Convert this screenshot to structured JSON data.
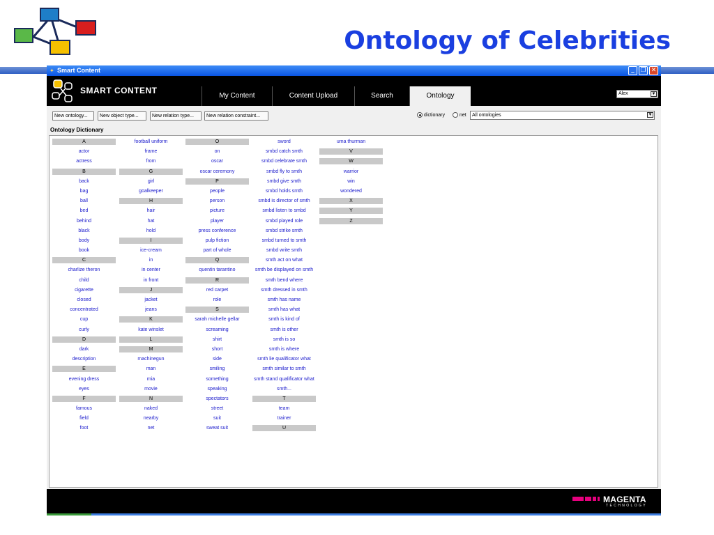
{
  "slide": {
    "title": "Ontology of Celebrities"
  },
  "window": {
    "title": "Smart Content"
  },
  "app": {
    "logo_text": "SMART CONTENT",
    "tabs": [
      {
        "label": "My Content"
      },
      {
        "label": "Content Upload"
      },
      {
        "label": "Search"
      },
      {
        "label": "Ontology",
        "active": true
      }
    ],
    "user": "Alex"
  },
  "toolbar": {
    "new_ontology": "New ontology...",
    "new_object_type": "New object type...",
    "new_relation_type": "New relation type...",
    "new_relation_constraint": "New relation constraint...",
    "radio_dictionary": "dictionary",
    "radio_net": "net",
    "selected_view": "dictionary",
    "ontology_select": "All ontologies"
  },
  "dictionary": {
    "legend": "Ontology Dictionary",
    "columns": [
      [
        "#A",
        "actor",
        "actress",
        "#B",
        "back",
        "bag",
        "ball",
        "bed",
        "behind",
        "black",
        "body",
        "book",
        "#C",
        "charlize theron",
        "child",
        "cigarette",
        "closed",
        "concentrated",
        "cup",
        "curly",
        "#D",
        "dark",
        "description",
        "#E",
        "evening dress",
        "eyes",
        "#F",
        "famous",
        "field",
        "foot"
      ],
      [
        "football uniform",
        "frame",
        "from",
        "#G",
        "girl",
        "goalkeeper",
        "#H",
        "hair",
        "hat",
        "hold",
        "#I",
        "ice-cream",
        "in",
        "in center",
        "in front",
        "#J",
        "jacket",
        "jeans",
        "#K",
        "kate winslet",
        "#L",
        "#M",
        "machinegun",
        "man",
        "mia",
        "movie",
        "#N",
        "naked",
        "nearby",
        "net"
      ],
      [
        "#O",
        "on",
        "oscar",
        "oscar ceremony",
        "#P",
        "people",
        "person",
        "picture",
        "player",
        "press conference",
        "pulp fiction",
        "part of whole",
        "#Q",
        "quentin tarantino",
        "#R",
        "red carpet",
        "role",
        "#S",
        "sarah michelle gellar",
        "screaming",
        "shirt",
        "short",
        "side",
        "smiling",
        "something",
        "speaking",
        "spectators",
        "street",
        "suit",
        "sweat suit"
      ],
      [
        "sword",
        "smbd catch smth",
        "smbd celebrate smth",
        "smbd fly to smth",
        "smbd give smth",
        "smbd holds smth",
        "smbd is director of smth",
        "smbd listen to smbd",
        "smbd played role",
        "smbd strike smth",
        "smbd turned to smth",
        "smbd write smth",
        "smth act on what",
        "smth be displayed on smth",
        "smth bend where",
        "smth dressed in smth",
        "smth has name",
        "smth has what",
        "smth is kind of",
        "smth is other",
        "smth is so",
        "smth is where",
        "smth lie qualificator what",
        "smth similar to smth",
        "smth stand qualificator what",
        "smth...",
        "#T",
        "team",
        "trainer",
        "#U"
      ],
      [
        "uma thurman",
        "#V",
        "#W",
        "warrior",
        "win",
        "wondered",
        "#X",
        "#Y",
        "#Z"
      ]
    ]
  },
  "footer": {
    "brand": "MAGENTA",
    "brand_sub": "TECHNOLOGY"
  },
  "colors": {
    "title_blue": "#1a3fe0",
    "link_blue": "#1a1acc",
    "magenta": "#e6007e"
  }
}
